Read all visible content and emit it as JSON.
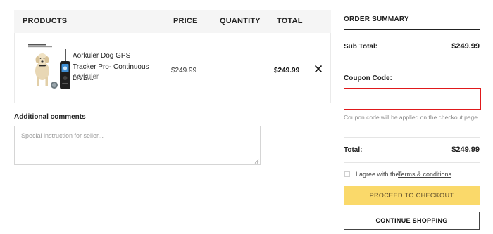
{
  "cart": {
    "headers": {
      "products": "PRODUCTS",
      "price": "PRICE",
      "quantity": "QUANTITY",
      "total": "TOTAL"
    },
    "items": [
      {
        "name": "Aorkuler Dog GPS Tracker Pro- Continuous LIVE...",
        "vendor": "Aorkuler",
        "price": "$249.99",
        "total": "$249.99",
        "thumbnail_icon": "dog-gps-tracker-product-image",
        "remove_icon": "close-icon"
      }
    ]
  },
  "comments": {
    "label": "Additional comments",
    "placeholder": "Special instruction for seller...",
    "value": ""
  },
  "summary": {
    "title": "ORDER SUMMARY",
    "subtotal_label": "Sub Total:",
    "subtotal_value": "$249.99",
    "coupon_label": "Coupon Code:",
    "coupon_value": "",
    "coupon_note": "Coupon code will be applied on the checkout page",
    "total_label": "Total:",
    "total_value": "$249.99",
    "agree_text": "I agree with the",
    "agree_link": "Terms & conditions",
    "agree_checked": false,
    "checkout_label": "PROCEED TO CHECKOUT",
    "continue_label": "CONTINUE SHOPPING"
  },
  "colors": {
    "checkout_bg": "#fad96a",
    "coupon_focus_border": "#e0191b",
    "header_bg": "#f5f5f5"
  }
}
